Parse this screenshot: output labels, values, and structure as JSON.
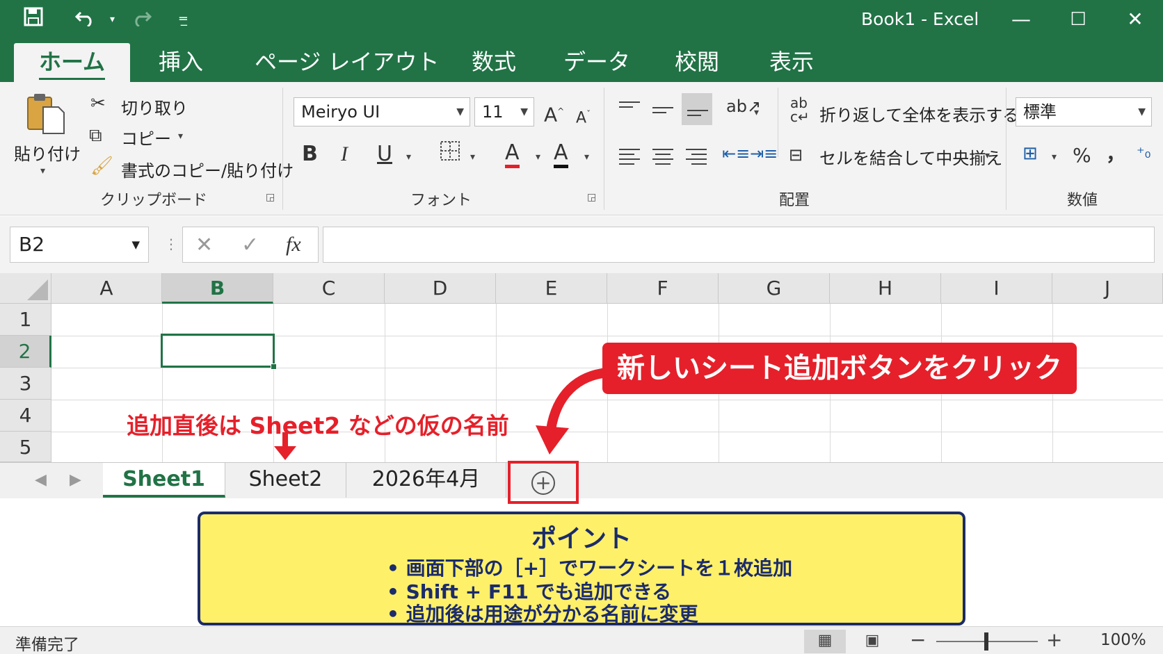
{
  "window": {
    "title": "Book1  -  Excel",
    "minimize": "—",
    "maximize": "☐",
    "close": "✕"
  },
  "quick_access": {
    "save_icon": "floppy-disk",
    "undo_icon": "undo",
    "redo_icon": "redo",
    "customize_icon": "customize-dropdown"
  },
  "ribbon_tabs": [
    "ホーム",
    "挿入",
    "ページ レイアウト",
    "数式",
    "データ",
    "校閲",
    "表示"
  ],
  "clipboard": {
    "paste": "貼り付け",
    "cut": "切り取り",
    "copy": "コピー",
    "format_painter": "書式のコピー/貼り付け",
    "label": "クリップボード"
  },
  "font": {
    "name": "Meiryo UI",
    "size": "11",
    "bold": "B",
    "italic": "I",
    "underline": "U",
    "font_color_letter": "A",
    "label": "フォント",
    "font_color": "#e5202a"
  },
  "alignment": {
    "wrap_text": "折り返して全体を表示する",
    "merge_center": "セルを結合して中央揃え",
    "label": "配置"
  },
  "number": {
    "format": "標準",
    "percent": "%",
    "comma": "，",
    "label": "数値"
  },
  "formula_bar": {
    "name_box": "B2",
    "fx": "fx",
    "cancel": "✕",
    "enter": "✓",
    "value": ""
  },
  "grid": {
    "columns": [
      "A",
      "B",
      "C",
      "D",
      "E",
      "F",
      "G",
      "H",
      "I",
      "J"
    ],
    "rows": [
      "1",
      "2",
      "3",
      "4",
      "5"
    ],
    "selected_column": "B",
    "selected_row": "2"
  },
  "sheet_tabs": {
    "tabs": [
      "Sheet1",
      "Sheet2",
      "2026年4月"
    ],
    "active": "Sheet1",
    "add_sheet": "+"
  },
  "annotations": {
    "add_button_callout": "新しいシート追加ボタンをクリック",
    "sheet2_note": "追加直後は Sheet2 などの仮の名前",
    "accent_red": "#e5202a"
  },
  "point_box": {
    "title": "ポイント",
    "items": [
      "•  画面下部の［+］でワークシートを１枚追加",
      "•  Shift + F11 でも追加できる",
      "•  追加後は用途が分かる名前に変更"
    ]
  },
  "status_bar": {
    "status": "準備完了",
    "zoom_out": "−",
    "zoom_in": "+",
    "zoom": "100%"
  },
  "colors": {
    "excel_green": "#217346",
    "point_box_bg": "#fff06a",
    "point_box_text": "#1b2b6b"
  }
}
